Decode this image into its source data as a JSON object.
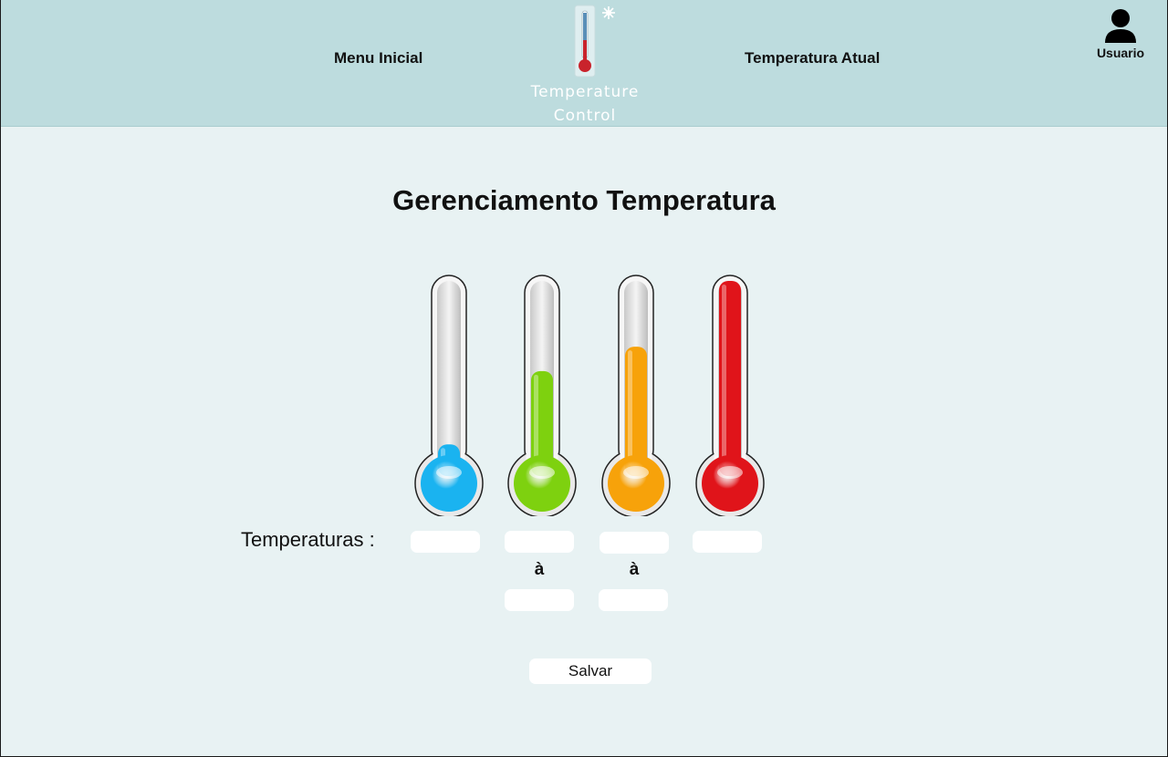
{
  "header": {
    "nav_menu": "Menu Inicial",
    "nav_current": "Temperatura Atual",
    "logo_line1": "Temperature",
    "logo_line2": "Control",
    "user_label": "Usuario"
  },
  "main": {
    "title": "Gerenciamento Temperatura",
    "temperatures_label": "Temperaturas :",
    "range_separator": "à",
    "save_label": "Salvar"
  },
  "thermometers": [
    {
      "id": "cold",
      "color": "#1ab3f0",
      "level": 0.13
    },
    {
      "id": "mild",
      "color": "#7ed10f",
      "level": 0.52
    },
    {
      "id": "warm",
      "color": "#f7a20a",
      "level": 0.65
    },
    {
      "id": "hot",
      "color": "#e0141a",
      "level": 1.0
    }
  ],
  "inputs": {
    "cold_value": "",
    "mild_from": "",
    "mild_to": "",
    "warm_from": "",
    "warm_to": "",
    "hot_value": ""
  },
  "colors": {
    "header_bg": "#bddcde",
    "page_bg": "#e8f2f3"
  }
}
